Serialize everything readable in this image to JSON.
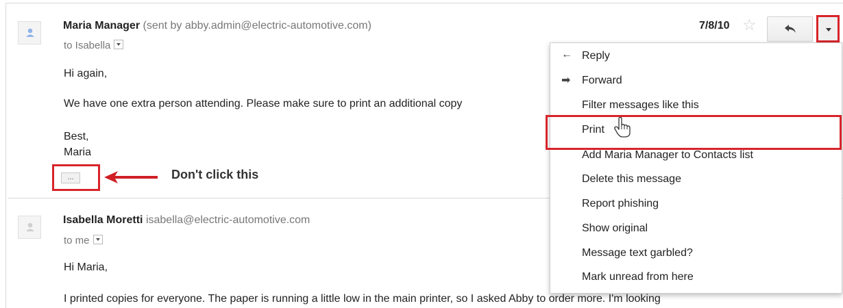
{
  "messages": [
    {
      "sender_name": "Maria Manager",
      "sender_meta": "(sent by abby.admin@electric-automotive.com)",
      "to": "to Isabella",
      "lines": [
        "Hi again,",
        "We have one extra person attending. Please make sure to print an additional copy",
        "Best,",
        "Maria"
      ],
      "date": "7/8/10"
    },
    {
      "sender_name": "Isabella Moretti",
      "sender_meta": "isabella@electric-automotive.com",
      "to": "to me",
      "lines": [
        "Hi Maria,",
        "I printed copies for everyone. The paper is running a little low in the main printer, so I asked Abby to order more. I'm looking"
      ]
    }
  ],
  "menu": {
    "items": [
      "Reply",
      "Forward",
      "Filter messages like this",
      "Print",
      "Add Maria Manager to Contacts list",
      "Delete this message",
      "Report phishing",
      "Show original",
      "Message text garbled?",
      "Mark unread from here"
    ]
  },
  "annotation": {
    "text": "Don't click this",
    "ellipsis": "..."
  },
  "icons": {
    "star": "☆",
    "reply_menu": "←",
    "forward_menu": "➡"
  },
  "colors": {
    "highlight": "#d8232a",
    "avatar": "#8fb4e8"
  }
}
